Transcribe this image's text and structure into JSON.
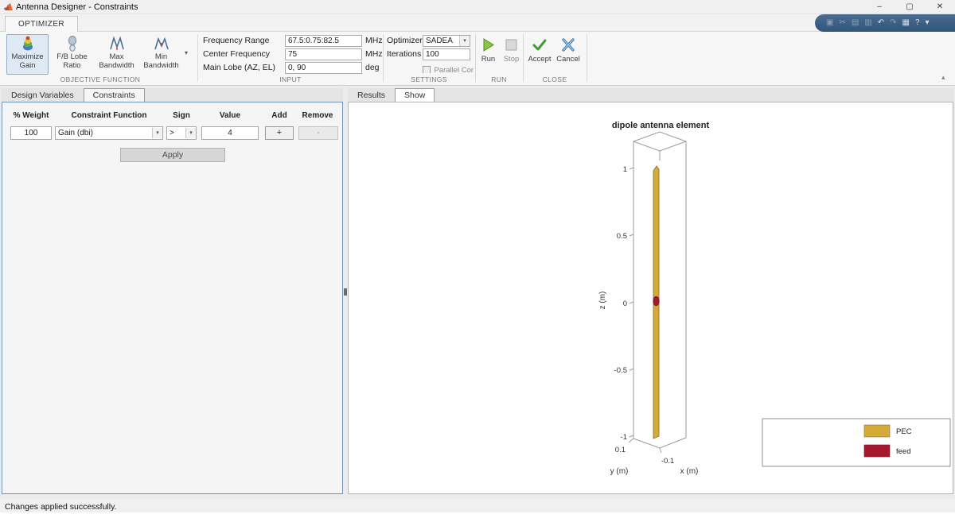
{
  "window": {
    "title": "Antenna Designer - Constraints"
  },
  "icons": {
    "minimize": "–",
    "maximize": "▢",
    "close": "✕",
    "dropdown": "▾",
    "collapse": "▴",
    "qat": [
      {
        "name": "save",
        "glyph": "▣"
      },
      {
        "name": "cut",
        "glyph": "✂"
      },
      {
        "name": "copy",
        "glyph": "▤"
      },
      {
        "name": "paste",
        "glyph": "▥"
      },
      {
        "name": "undo",
        "glyph": "↶"
      },
      {
        "name": "redo",
        "glyph": "↷"
      },
      {
        "name": "layout",
        "glyph": "▦"
      },
      {
        "name": "help",
        "glyph": "?"
      },
      {
        "name": "more",
        "glyph": "▾"
      }
    ]
  },
  "ribbon": {
    "tab_label": "OPTIMIZER",
    "objective": {
      "section_label": "OBJECTIVE FUNCTION",
      "buttons": [
        {
          "label": "Maximize Gain"
        },
        {
          "label": "F/B Lobe Ratio"
        },
        {
          "label": "Max Bandwidth"
        },
        {
          "label": "Min Bandwidth"
        }
      ]
    },
    "input": {
      "section_label": "INPUT",
      "rows": [
        {
          "label": "Frequency Range",
          "value": "67.5:0.75:82.5",
          "unit": "MHz"
        },
        {
          "label": "Center Frequency",
          "value": "75",
          "unit": "MHz"
        },
        {
          "label": "Main Lobe (AZ, EL)",
          "value": "0, 90",
          "unit": "deg"
        }
      ]
    },
    "settings": {
      "section_label": "SETTINGS",
      "optimizer_label": "Optimizer",
      "optimizer_value": "SADEA",
      "iterations_label": "Iterations",
      "iterations_value": "100",
      "parallel_label": "Parallel Computing"
    },
    "run": {
      "section_label": "RUN",
      "run_label": "Run",
      "stop_label": "Stop"
    },
    "close": {
      "section_label": "CLOSE",
      "accept_label": "Accept",
      "cancel_label": "Cancel"
    }
  },
  "left_panel": {
    "tabs": [
      {
        "label": "Design Variables"
      },
      {
        "label": "Constraints"
      }
    ],
    "headers": [
      "% Weight",
      "Constraint Function",
      "Sign",
      "Value",
      "Add",
      "Remove"
    ],
    "row": {
      "weight": "100",
      "function": "Gain (dbi)",
      "sign": ">",
      "value": "4",
      "add_label": "+",
      "remove_label": "-"
    },
    "apply_label": "Apply"
  },
  "right_panel": {
    "tabs": [
      {
        "label": "Results"
      },
      {
        "label": "Show"
      }
    ]
  },
  "chart_data": {
    "type": "3d-geometry",
    "title": "dipole antenna element",
    "xlabel": "x (m)",
    "ylabel": "y (m)",
    "zlabel": "z (m)",
    "xlim": [
      -0.1,
      0.1
    ],
    "ylim": [
      -0.1,
      0.1
    ],
    "zlim": [
      -1,
      1
    ],
    "z_tick_labels": [
      "1",
      "0.5",
      "0",
      "-0.5",
      "-1"
    ],
    "y_tick_label": "0.1",
    "x_tick_label": "-0.1",
    "legend": [
      {
        "label": "PEC",
        "color": "#d4ab39"
      },
      {
        "label": "feed",
        "color": "#a5182e"
      }
    ]
  },
  "status": {
    "text": "Changes applied successfully."
  }
}
